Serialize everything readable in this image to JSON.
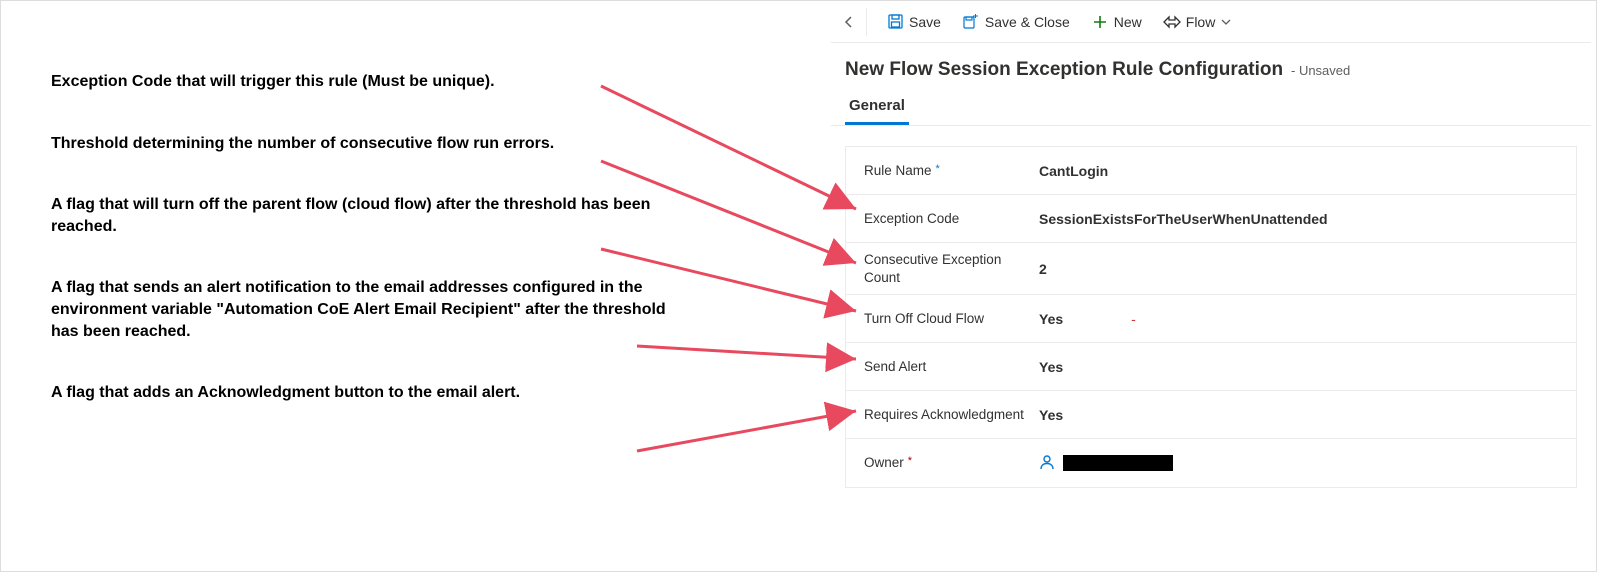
{
  "annotations": {
    "exception_code": "Exception Code that will trigger this rule (Must be unique).",
    "threshold": "Threshold determining the number of consecutive flow run errors.",
    "turn_off": "A flag that will turn off the parent flow (cloud flow) after the threshold has been reached.",
    "send_alert": "A flag that sends an alert notification to the email addresses configured in the environment variable \"Automation CoE Alert Email Recipient\" after the threshold has been reached.",
    "ack": "A flag that adds an Acknowledgment button to the email alert."
  },
  "commandbar": {
    "save": "Save",
    "save_close": "Save & Close",
    "new": "New",
    "flow": "Flow"
  },
  "header": {
    "title": "New Flow Session Exception Rule Configuration",
    "status": "- Unsaved"
  },
  "tab": {
    "general": "General"
  },
  "form": {
    "rule_name_label": "Rule Name",
    "rule_name_value": "CantLogin",
    "exception_code_label": "Exception Code",
    "exception_code_value": "SessionExistsForTheUserWhenUnattended",
    "consec_label": "Consecutive Exception Count",
    "consec_value": "2",
    "turnoff_label": "Turn Off Cloud Flow",
    "turnoff_value": "Yes",
    "sendalert_label": "Send Alert",
    "sendalert_value": "Yes",
    "reqack_label": "Requires Acknowledgment",
    "reqack_value": "Yes",
    "owner_label": "Owner"
  }
}
